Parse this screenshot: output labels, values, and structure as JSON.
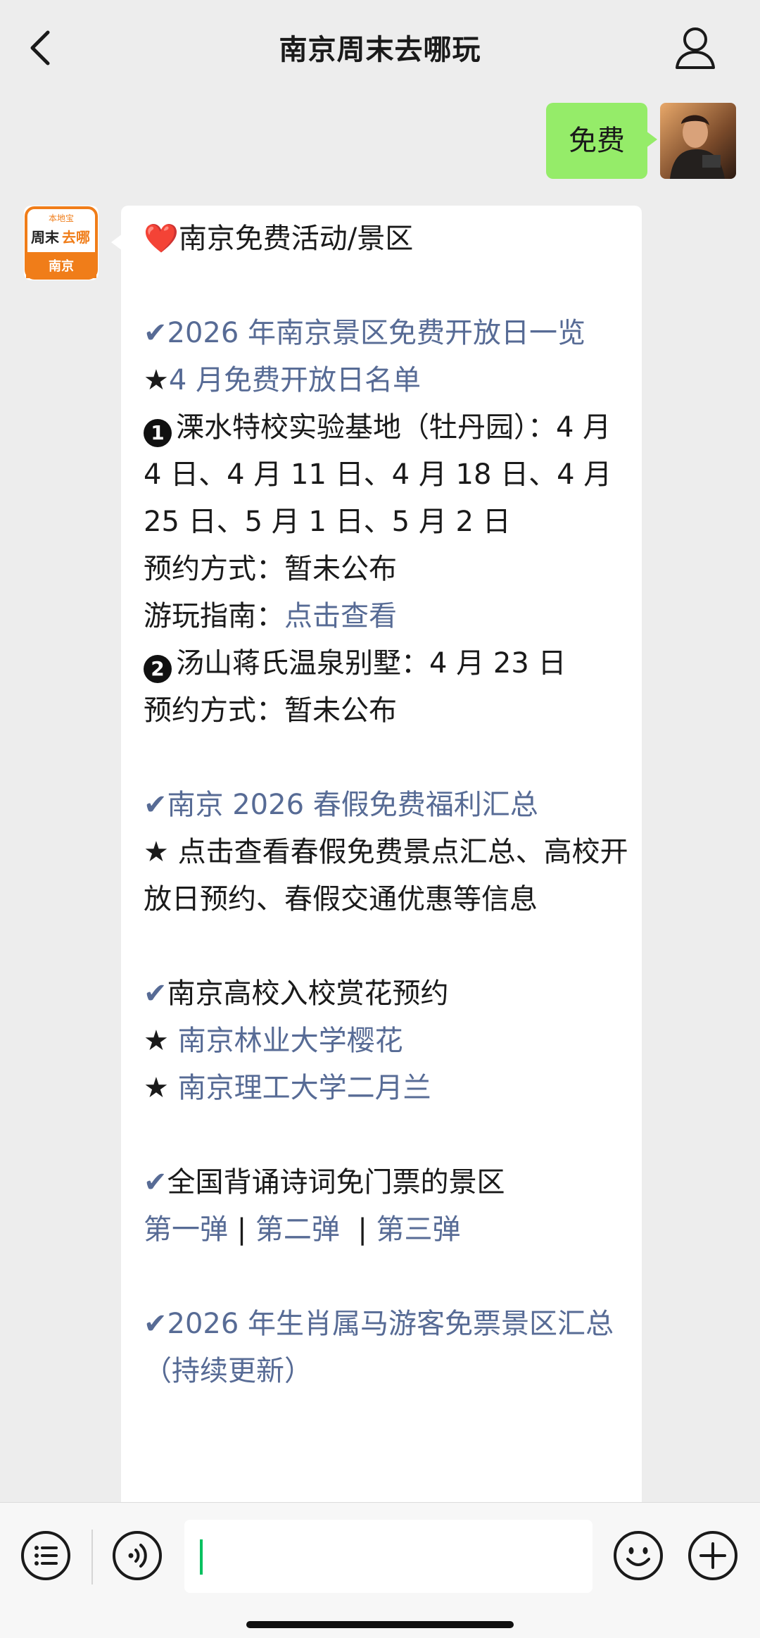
{
  "header": {
    "title": "南京周末去哪玩",
    "back_icon": "chevron-left-icon",
    "profile_icon": "person-icon"
  },
  "outgoing_message": {
    "text": "免费"
  },
  "official_account_avatar": {
    "top_text": "本地宝",
    "brand_part1": "周末",
    "brand_part2": "去哪",
    "city": "南京",
    "accent_color": "#f07d19"
  },
  "reply": {
    "heart": "❤️",
    "heading": "南京免费活动/景区",
    "check_mark": "✔",
    "section1": {
      "title": "2026 年南京景区免费开放日一览",
      "star_prefix": "★",
      "subtitle": "4 月免费开放日名单",
      "item1_num": "1",
      "item1_text": "溧水特校实验基地（牡丹园）：4 月 4 日、4 月 11 日、4 月 18 日、4 月 25 日、5 月 1 日、5 月 2 日",
      "booking_label": "预约方式：",
      "booking_value": "暂未公布",
      "guide_label": "游玩指南：",
      "guide_link": "点击查看",
      "item2_num": "2",
      "item2_text": "汤山蒋氏温泉别墅：4 月 23 日",
      "booking2_label": "预约方式：",
      "booking2_value": "暂未公布"
    },
    "section2": {
      "title": "南京 2026 春假免费福利汇总",
      "star_prefix": "★",
      "desc": "点击查看春假免费景点汇总、高校开放日预约、春假交通优惠等信息"
    },
    "section3": {
      "title": "南京高校入校赏花预约",
      "star_prefix": "★",
      "link1": "南京林业大学樱花",
      "link2": "南京理工大学二月兰"
    },
    "section4": {
      "title": "全国背诵诗词免门票的景区",
      "link1": "第一弹",
      "sep1": " | ",
      "link2": "第二弹",
      "sep2": "  | ",
      "link3": "第三弹"
    },
    "section5": {
      "title": "2026 年生肖属马游客免票景区汇总（持续更新）"
    }
  },
  "input_bar": {
    "voice_icon": "voice-icon",
    "menu_icon": "list-menu-icon",
    "emoji_icon": "emoji-icon",
    "plus_icon": "plus-icon",
    "input_value": ""
  },
  "colors": {
    "background": "#ededed",
    "sent_bubble": "#95ec69",
    "link": "#576b95",
    "caret": "#07c160"
  }
}
